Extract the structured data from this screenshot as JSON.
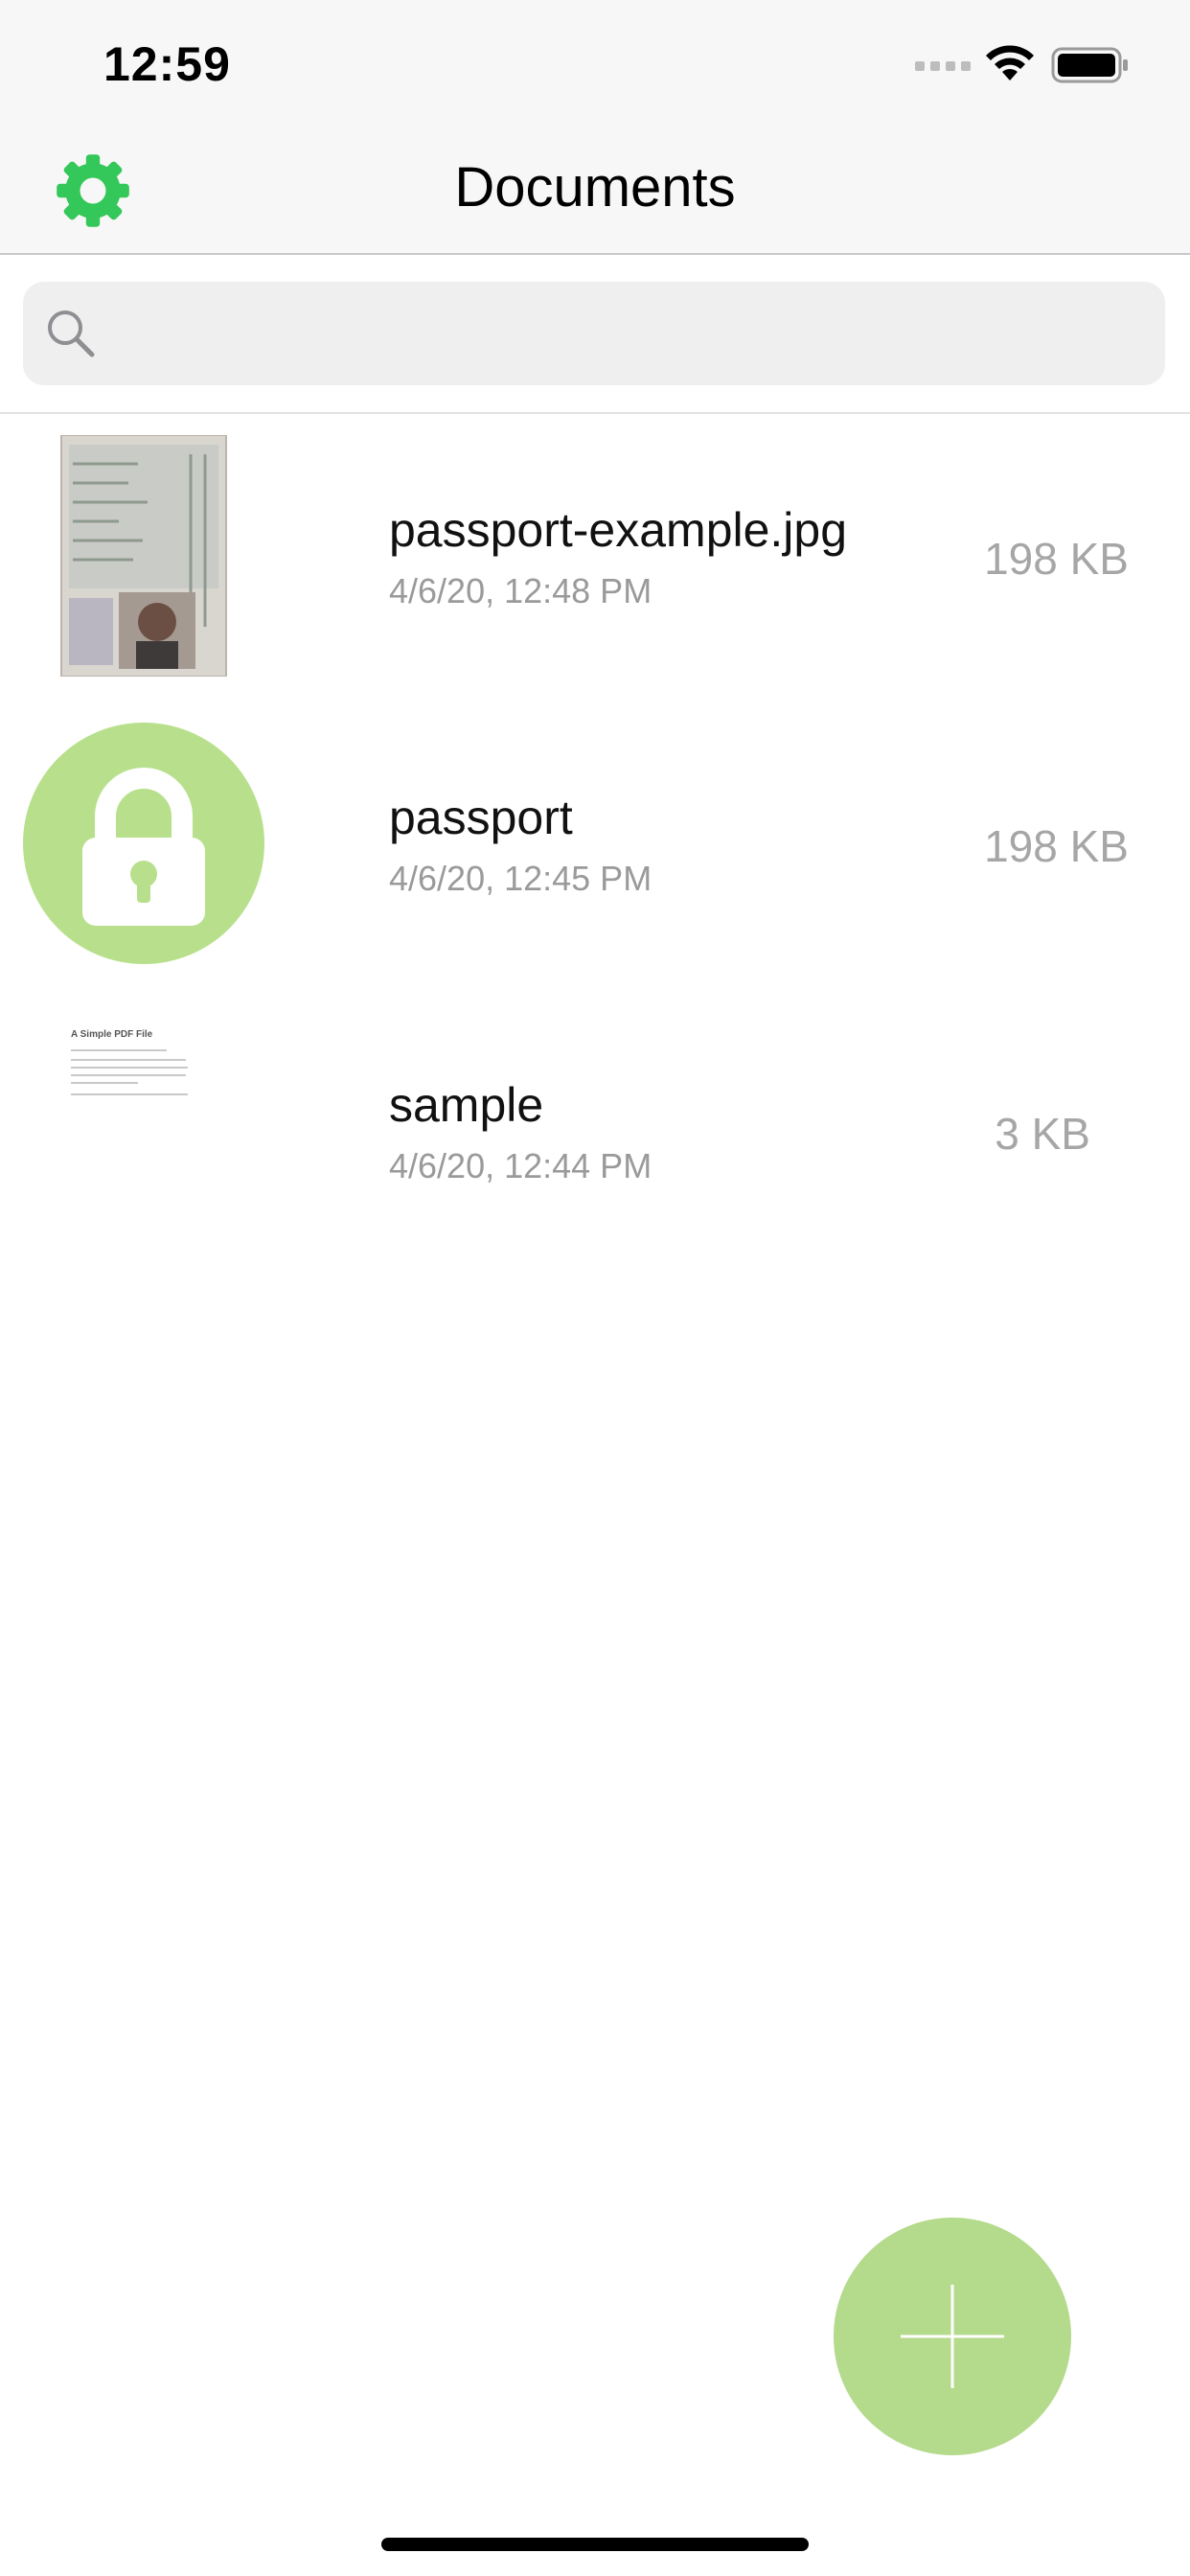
{
  "status_bar": {
    "time": "12:59",
    "icons": [
      "signal-icon",
      "wifi-icon",
      "battery-icon"
    ]
  },
  "nav": {
    "title": "Documents",
    "settings_icon": "gear-icon",
    "settings_icon_color": "#34c759"
  },
  "search": {
    "value": "",
    "placeholder": "",
    "icon": "search-icon"
  },
  "documents": [
    {
      "name": "passport-example.jpg",
      "date": "4/6/20, 12:48 PM",
      "size": "198 KB",
      "thumbnail": "passport-image"
    },
    {
      "name": "passport",
      "date": "4/6/20, 12:45 PM",
      "size": "198 KB",
      "thumbnail": "lock-icon"
    },
    {
      "name": "sample",
      "date": "4/6/20, 12:44 PM",
      "size": "3 KB",
      "thumbnail": "pdf-preview"
    }
  ],
  "pdf_preview_title": "A Simple PDF File",
  "fab": {
    "icon": "plus-icon",
    "color": "#b4da8c"
  },
  "colors": {
    "accent_green": "#34c759",
    "lock_green": "#b8e08c",
    "secondary_text": "#9a9a9a"
  }
}
